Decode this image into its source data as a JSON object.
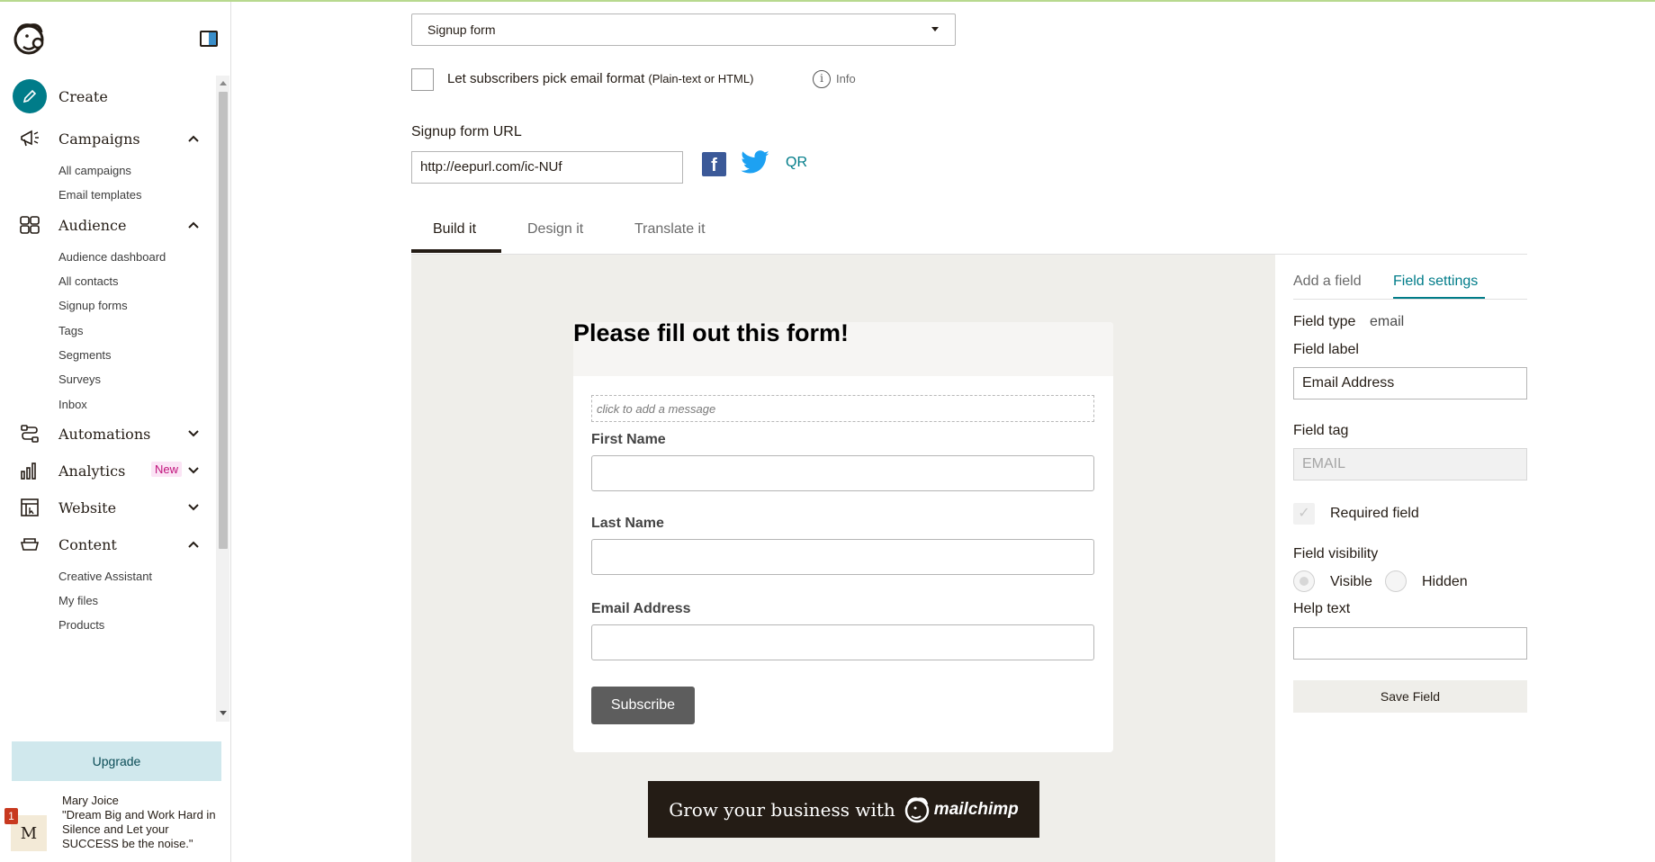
{
  "sidebar": {
    "nav": [
      {
        "label": "Create",
        "icon": "pencil-icon"
      },
      {
        "label": "Campaigns",
        "icon": "megaphone-icon",
        "expanded": true,
        "items": [
          "All campaigns",
          "Email templates"
        ]
      },
      {
        "label": "Audience",
        "icon": "audience-icon",
        "expanded": true,
        "items": [
          "Audience dashboard",
          "All contacts",
          "Signup forms",
          "Tags",
          "Segments",
          "Surveys",
          "Inbox"
        ]
      },
      {
        "label": "Automations",
        "icon": "automations-icon",
        "expanded": false
      },
      {
        "label": "Analytics",
        "icon": "analytics-icon",
        "expanded": false,
        "badge": "New"
      },
      {
        "label": "Website",
        "icon": "website-icon",
        "expanded": false
      },
      {
        "label": "Content",
        "icon": "content-icon",
        "expanded": true,
        "items": [
          "Creative Assistant",
          "My files",
          "Products"
        ]
      }
    ],
    "upgrade_label": "Upgrade",
    "profile": {
      "notification_count": "1",
      "avatar_letter": "M",
      "name": "Mary Joice",
      "quote": "\"Dream Big and Work Hard in Silence and Let your SUCCESS be the noise.\""
    }
  },
  "main": {
    "form_select_value": "Signup form",
    "format_checkbox": {
      "label": "Let subscribers pick email format",
      "label_small": "(Plain-text or HTML)",
      "checked": false
    },
    "info_label": "Info",
    "url_heading": "Signup form URL",
    "url_value": "http://eepurl.com/ic-NUf",
    "qr_label": "QR",
    "tabs": [
      "Build it",
      "Design it",
      "Translate it"
    ],
    "active_tab": "Build it"
  },
  "form_preview": {
    "title": "Please fill out this form!",
    "message_placeholder": "click to add a message",
    "fields": [
      "First Name",
      "Last Name",
      "Email Address"
    ],
    "submit_label": "Subscribe",
    "banner_text": "Grow your business with",
    "banner_brand": "mailchimp"
  },
  "right_panel": {
    "tabs": [
      "Add a field",
      "Field settings"
    ],
    "active_tab": "Field settings",
    "field_type_label": "Field type",
    "field_type_value": "email",
    "field_label_label": "Field label",
    "field_label_value": "Email Address",
    "field_tag_label": "Field tag",
    "field_tag_value": "EMAIL",
    "required_label": "Required field",
    "visibility_label": "Field visibility",
    "visibility_options": [
      "Visible",
      "Hidden"
    ],
    "visibility_selected": "Visible",
    "help_text_label": "Help text",
    "help_text_value": "",
    "save_label": "Save Field"
  },
  "colors": {
    "accent": "#007c89",
    "text": "#241c15",
    "canvas_bg": "#efeeea",
    "new_badge_bg": "#fbe4f5"
  }
}
